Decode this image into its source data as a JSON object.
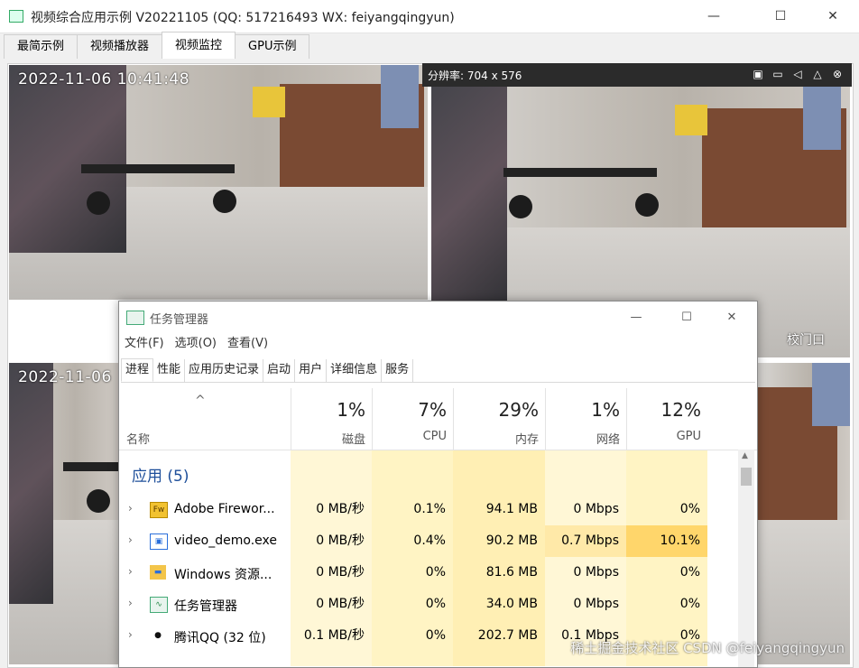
{
  "window": {
    "title": "视频综合应用示例 V20221105 (QQ: 517216493 WX: feiyangqingyun)",
    "minimize": "—",
    "maximize": "☐",
    "close": "✕"
  },
  "tabs": [
    "最简示例",
    "视频播放器",
    "视频监控",
    "GPU示例"
  ],
  "cameras": {
    "timestamp_1": "2022-11-06 10:41:48",
    "timestamp_3": "2022-11-06",
    "resolution": "分辨率: 704 x 576",
    "label_2": "校门口"
  },
  "task_manager": {
    "title": "任务管理器",
    "menu": [
      "文件(F)",
      "选项(O)",
      "查看(V)"
    ],
    "tabs": [
      "进程",
      "性能",
      "应用历史记录",
      "启动",
      "用户",
      "详细信息",
      "服务"
    ],
    "sort_indicator": "^",
    "name_header": "名称",
    "columns": [
      {
        "pct": "1%",
        "label": "磁盘"
      },
      {
        "pct": "7%",
        "label": "CPU"
      },
      {
        "pct": "29%",
        "label": "内存"
      },
      {
        "pct": "1%",
        "label": "网络"
      },
      {
        "pct": "12%",
        "label": "GPU"
      }
    ],
    "group": "应用 (5)",
    "rows": [
      {
        "name": "Adobe Firewor...",
        "disk": "0 MB/秒",
        "cpu": "0.1%",
        "mem": "94.1 MB",
        "net": "0 Mbps",
        "gpu": "0%"
      },
      {
        "name": "video_demo.exe",
        "disk": "0 MB/秒",
        "cpu": "0.4%",
        "mem": "90.2 MB",
        "net": "0.7 Mbps",
        "gpu": "10.1%"
      },
      {
        "name": "Windows 资源...",
        "disk": "0 MB/秒",
        "cpu": "0%",
        "mem": "81.6 MB",
        "net": "0 Mbps",
        "gpu": "0%"
      },
      {
        "name": "任务管理器",
        "disk": "0 MB/秒",
        "cpu": "0%",
        "mem": "34.0 MB",
        "net": "0 Mbps",
        "gpu": "0%"
      },
      {
        "name": "腾讯QQ (32 位)",
        "disk": "0.1 MB/秒",
        "cpu": "0%",
        "mem": "202.7 MB",
        "net": "0.1 Mbps",
        "gpu": "0%"
      }
    ],
    "icons": [
      "fw-icon",
      "exe-icon",
      "folder-icon",
      "taskmgr-icon",
      "qq-icon"
    ]
  },
  "watermark": "稀土掘金技术社区  CSDN @feiyangqingyun",
  "colors": {
    "heat_light": "#fff4c4",
    "heat_medium": "#ffe9a8",
    "heat_strong": "#ffd66b",
    "group": "#1e4f9a"
  }
}
